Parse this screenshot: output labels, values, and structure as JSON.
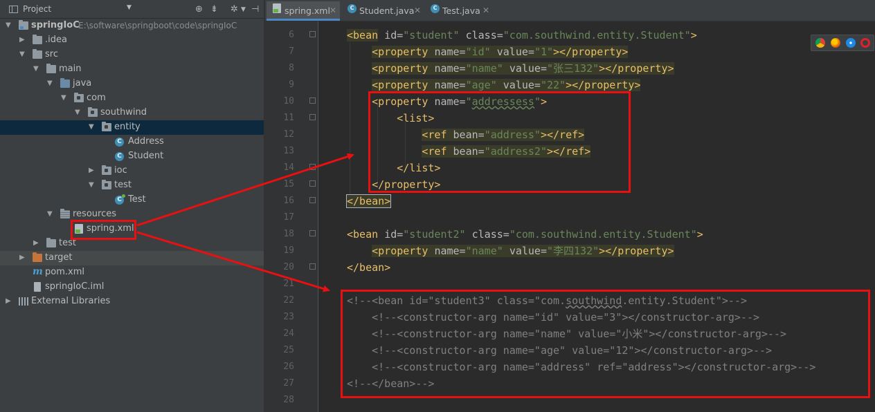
{
  "project_panel": {
    "title": "Project",
    "tree": [
      {
        "label": "springIoC",
        "path": "E:\\software\\springboot\\code\\springIoC",
        "icon": "module-folder-icon",
        "expanded": true
      },
      {
        "label": ".idea",
        "icon": "folder-icon",
        "expanded": false
      },
      {
        "label": "src",
        "icon": "folder-icon",
        "expanded": true
      },
      {
        "label": "main",
        "icon": "folder-icon",
        "expanded": true
      },
      {
        "label": "java",
        "icon": "source-folder-icon",
        "expanded": true
      },
      {
        "label": "com",
        "icon": "package-icon",
        "expanded": true
      },
      {
        "label": "southwind",
        "icon": "package-icon",
        "expanded": true
      },
      {
        "label": "entity",
        "icon": "package-icon",
        "expanded": true,
        "selected": true
      },
      {
        "label": "Address",
        "icon": "class-icon"
      },
      {
        "label": "Student",
        "icon": "class-icon"
      },
      {
        "label": "ioc",
        "icon": "package-icon",
        "expanded": false
      },
      {
        "label": "test",
        "icon": "package-icon",
        "expanded": true
      },
      {
        "label": "Test",
        "icon": "test-class-icon"
      },
      {
        "label": "resources",
        "icon": "resources-folder-icon",
        "expanded": true
      },
      {
        "label": "spring.xml",
        "icon": "xml-file-icon"
      },
      {
        "label": "test",
        "icon": "folder-icon",
        "expanded": false
      },
      {
        "label": "target",
        "icon": "excluded-folder-icon",
        "expanded": false
      },
      {
        "label": "pom.xml",
        "icon": "maven-icon"
      },
      {
        "label": "springIoC.iml",
        "icon": "iml-file-icon"
      },
      {
        "label": "External Libraries",
        "icon": "library-icon",
        "expanded": false
      }
    ]
  },
  "tabs": [
    {
      "label": "spring.xml",
      "icon": "xml-file-icon",
      "active": true
    },
    {
      "label": "Student.java",
      "icon": "class-icon",
      "active": false
    },
    {
      "label": "Test.java",
      "icon": "test-class-icon",
      "active": false
    }
  ],
  "editor": {
    "line_numbers": [
      "6",
      "7",
      "8",
      "9",
      "10",
      "11",
      "12",
      "13",
      "14",
      "15",
      "16",
      "17",
      "18",
      "19",
      "20",
      "21",
      "22",
      "23",
      "24",
      "25",
      "26",
      "27",
      "28"
    ]
  },
  "colors": {
    "tag": "#e8bf6a",
    "attr_value": "#6a8759",
    "comment": "#808080",
    "annotation_red": "#e81010"
  },
  "browser_icons": [
    "chrome-icon",
    "firefox-icon",
    "safari-icon",
    "opera-icon"
  ]
}
